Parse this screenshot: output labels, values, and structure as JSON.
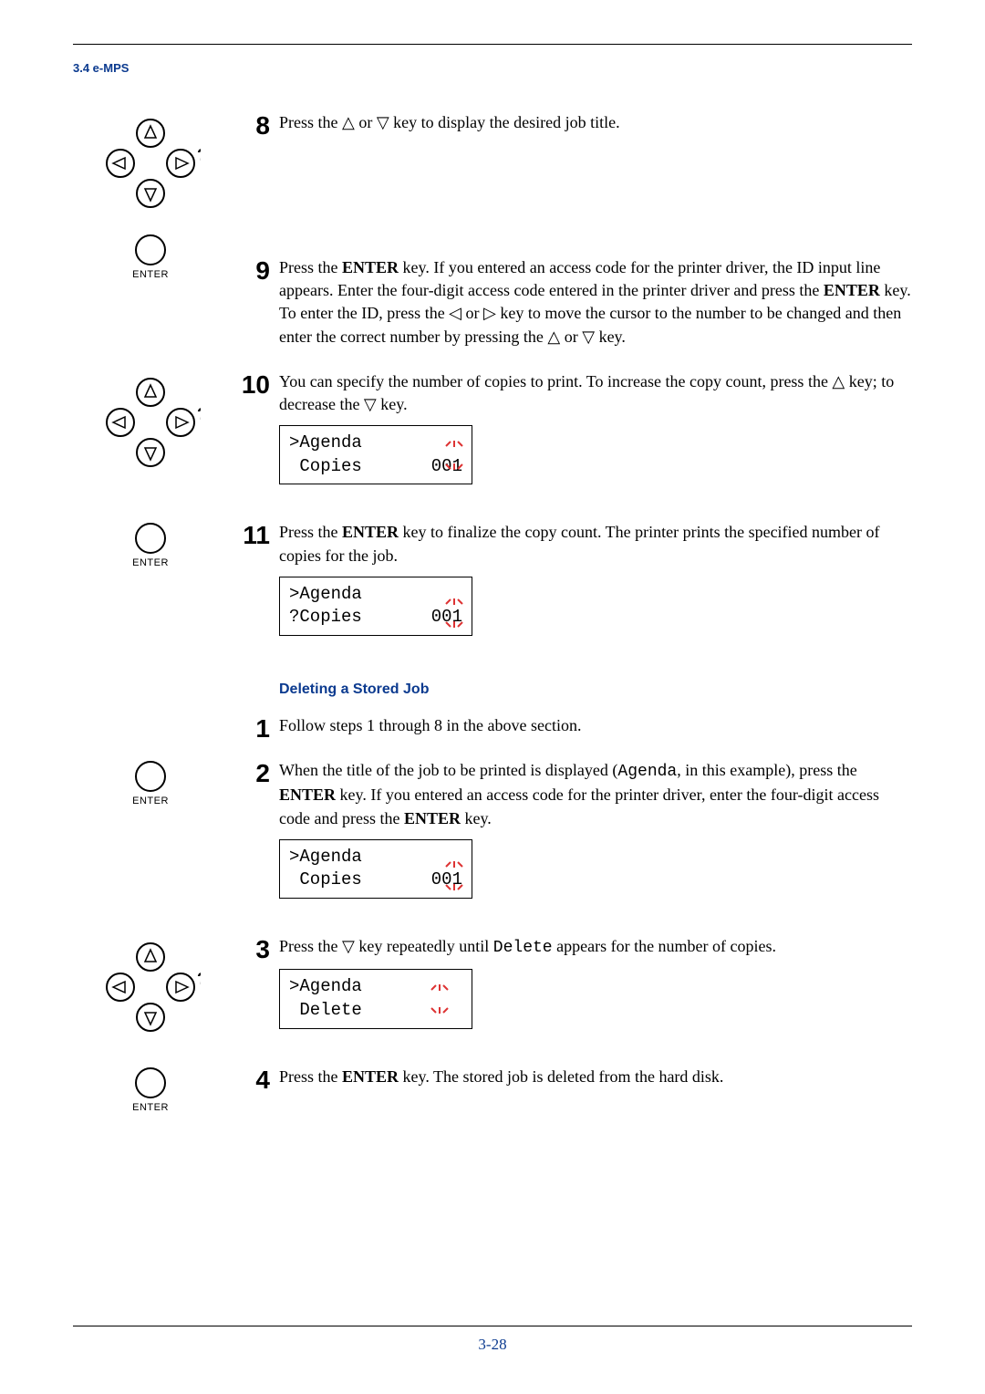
{
  "header": {
    "section": "3.4 e-MPS"
  },
  "steps": {
    "s8": {
      "num": "8",
      "text": "Press the △ or ▽ key to display the desired job title."
    },
    "s9": {
      "num": "9",
      "p1a": "Press the ",
      "enter": "ENTER",
      "p1b": " key.  If  you entered an access code for the printer driver, the ID input line appears. Enter the four-digit access code entered in the printer driver and press the ",
      "p1c": " key. To enter the ID, press the ◁ or ▷ key to move the cursor to the number to be changed and then enter the correct number by pressing the △ or ▽ key."
    },
    "s10": {
      "num": "10",
      "text": "You can specify the number of copies to print. To increase the copy count, press the △ key; to decrease the ▽ key.",
      "disp_l1": ">Agenda",
      "disp_l2a": " Copies",
      "disp_l2b": "001"
    },
    "s11": {
      "num": "11",
      "p1a": "Press the ",
      "enter": "ENTER",
      "p1b": " key to finalize the copy count. The printer prints the specified number of copies for the job.",
      "disp_l1": ">Agenda",
      "disp_l2a": "?Copies",
      "disp_l2b": "001"
    }
  },
  "subheading": "Deleting a Stored Job",
  "del": {
    "d1": {
      "num": "1",
      "text": "Follow steps 1 through 8 in the above section."
    },
    "d2": {
      "num": "2",
      "p1a": "When the title of the job to be printed is displayed (",
      "mono": "Agenda",
      "p1b": ", in this example), press the ",
      "enter": "ENTER",
      "p1c": " key.  If you entered an access code for the printer driver, enter the four-digit access code and press the ",
      "p1d": " key.",
      "disp_l1": ">Agenda",
      "disp_l2a": " Copies",
      "disp_l2b": "001"
    },
    "d3": {
      "num": "3",
      "p1a": "Press the ▽ key repeatedly until ",
      "mono": "Delete",
      "p1b": " appears for the number of copies.",
      "disp_l1": ">Agenda",
      "disp_l2": " Delete"
    },
    "d4": {
      "num": "4",
      "p1a": "Press the ",
      "enter": "ENTER",
      "p1b": " key. The stored job is deleted from the hard disk."
    }
  },
  "footer": {
    "page": "3-28"
  },
  "labels": {
    "enter": "ENTER"
  }
}
